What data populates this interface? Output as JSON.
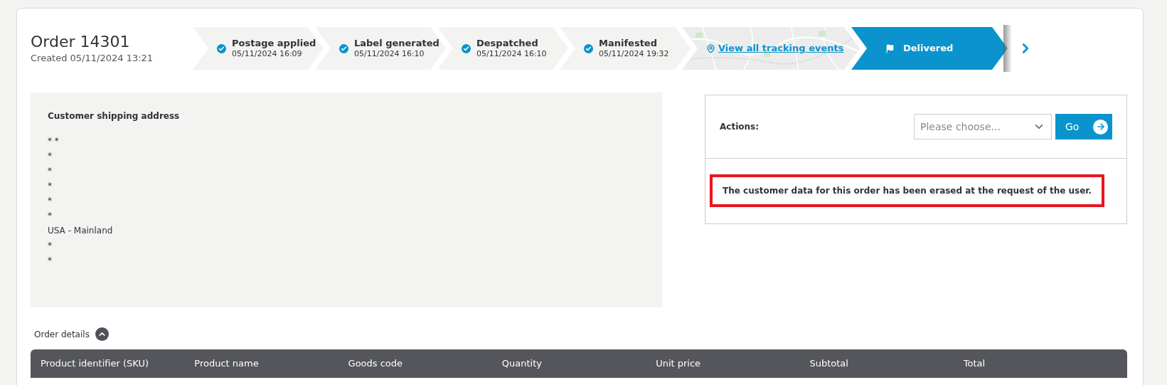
{
  "order": {
    "title": "Order 14301",
    "created": "Created 05/11/2024 13:21"
  },
  "steps": [
    {
      "kind": "step",
      "label": "Postage applied",
      "time": "05/11/2024 16:09",
      "done": true
    },
    {
      "kind": "step",
      "label": "Label generated",
      "time": "05/11/2024 16:10",
      "done": true
    },
    {
      "kind": "step",
      "label": "Despatched",
      "time": "05/11/2024 16:10",
      "done": true
    },
    {
      "kind": "step",
      "label": "Manifested",
      "time": "05/11/2024 19:32",
      "done": true
    },
    {
      "kind": "map",
      "label": "View all tracking events"
    },
    {
      "kind": "current",
      "label": "Delivered"
    }
  ],
  "address": {
    "heading": "Customer shipping address",
    "lines": [
      "* *",
      "*",
      "*",
      "*",
      "*",
      "*",
      "USA - Mainland",
      "*",
      "*"
    ]
  },
  "actions": {
    "label": "Actions:",
    "placeholder": "Please choose...",
    "button": "Go",
    "notice": "The customer data for this order has been erased at the request of the user.",
    "notice_highlighted": true
  },
  "order_details": {
    "label": "Order details",
    "expanded": true
  },
  "table": {
    "columns": [
      "Product identifier (SKU)",
      "Product name",
      "Goods code",
      "Quantity",
      "Unit price",
      "Subtotal",
      "Total"
    ]
  }
}
